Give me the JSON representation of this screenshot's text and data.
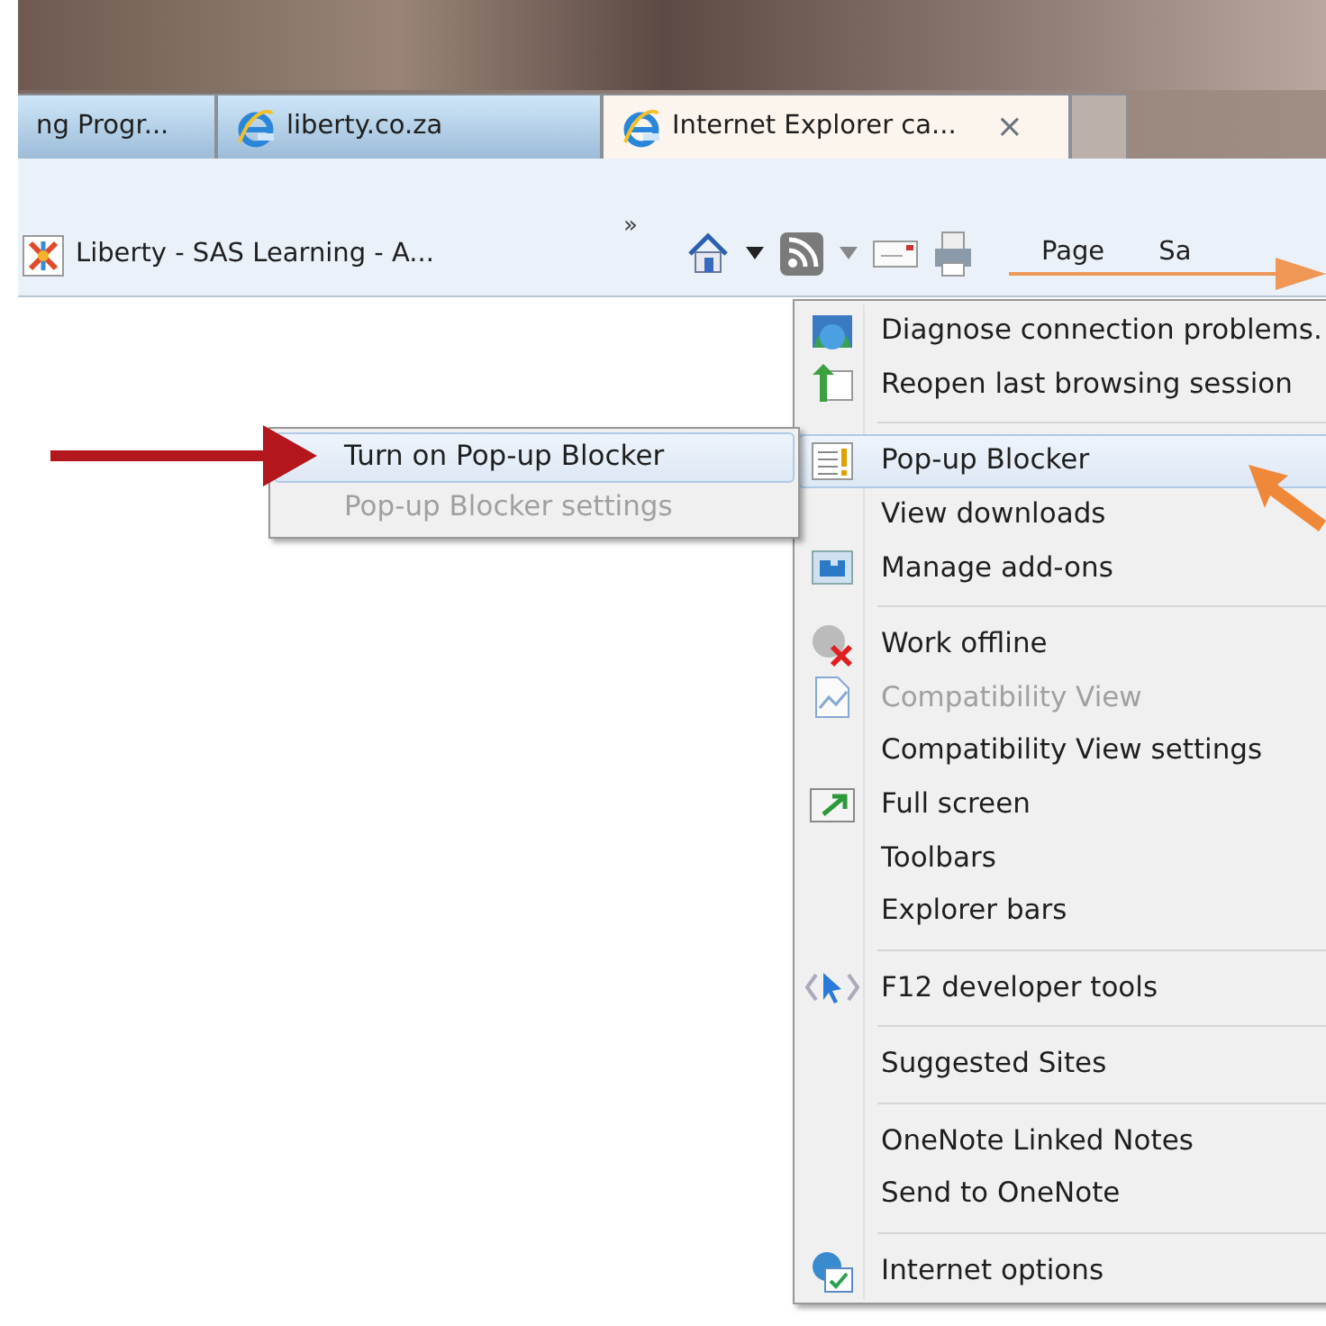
{
  "tabs": [
    {
      "label": "ng Progr...",
      "selected": false,
      "icon": false
    },
    {
      "label": "liberty.co.za",
      "selected": false,
      "icon": true
    },
    {
      "label": "Internet Explorer ca...",
      "selected": true,
      "icon": true,
      "close": "×"
    }
  ],
  "favorites_bar": {
    "item": "Liberty - SAS Learning - A...",
    "chevron": "»"
  },
  "command_bar": {
    "items": [
      "Page",
      "Sa"
    ]
  },
  "tools_menu": {
    "items": [
      {
        "kind": "item",
        "label": "Diagnose connection problems.",
        "disabled": false,
        "selected": false
      },
      {
        "kind": "item",
        "label": "Reopen last browsing session",
        "disabled": false,
        "selected": false
      },
      {
        "kind": "separator"
      },
      {
        "kind": "item",
        "label": "Pop-up Blocker",
        "disabled": false,
        "selected": true
      },
      {
        "kind": "item",
        "label": "View downloads",
        "disabled": false,
        "selected": false
      },
      {
        "kind": "item",
        "label": "Manage add-ons",
        "disabled": false,
        "selected": false
      },
      {
        "kind": "separator"
      },
      {
        "kind": "item",
        "label": "Work offline",
        "disabled": false,
        "selected": false
      },
      {
        "kind": "item",
        "label": "Compatibility View",
        "disabled": true,
        "selected": false
      },
      {
        "kind": "item",
        "label": "Compatibility View settings",
        "disabled": false,
        "selected": false
      },
      {
        "kind": "item",
        "label": "Full screen",
        "disabled": false,
        "selected": false
      },
      {
        "kind": "item",
        "label": "Toolbars",
        "disabled": false,
        "selected": false
      },
      {
        "kind": "item",
        "label": "Explorer bars",
        "disabled": false,
        "selected": false
      },
      {
        "kind": "separator"
      },
      {
        "kind": "item",
        "label": "F12 developer tools",
        "disabled": false,
        "selected": false
      },
      {
        "kind": "separator"
      },
      {
        "kind": "item",
        "label": "Suggested Sites",
        "disabled": false,
        "selected": false
      },
      {
        "kind": "separator"
      },
      {
        "kind": "item",
        "label": "OneNote Linked Notes",
        "disabled": false,
        "selected": false
      },
      {
        "kind": "item",
        "label": "Send to OneNote",
        "disabled": false,
        "selected": false
      },
      {
        "kind": "separator"
      },
      {
        "kind": "item",
        "label": "Internet options",
        "disabled": false,
        "selected": false
      }
    ]
  },
  "popup_submenu": {
    "items": [
      {
        "label": "Turn on Pop-up Blocker",
        "disabled": false,
        "selected": true
      },
      {
        "label": "Pop-up Blocker settings",
        "disabled": true,
        "selected": false
      }
    ]
  }
}
